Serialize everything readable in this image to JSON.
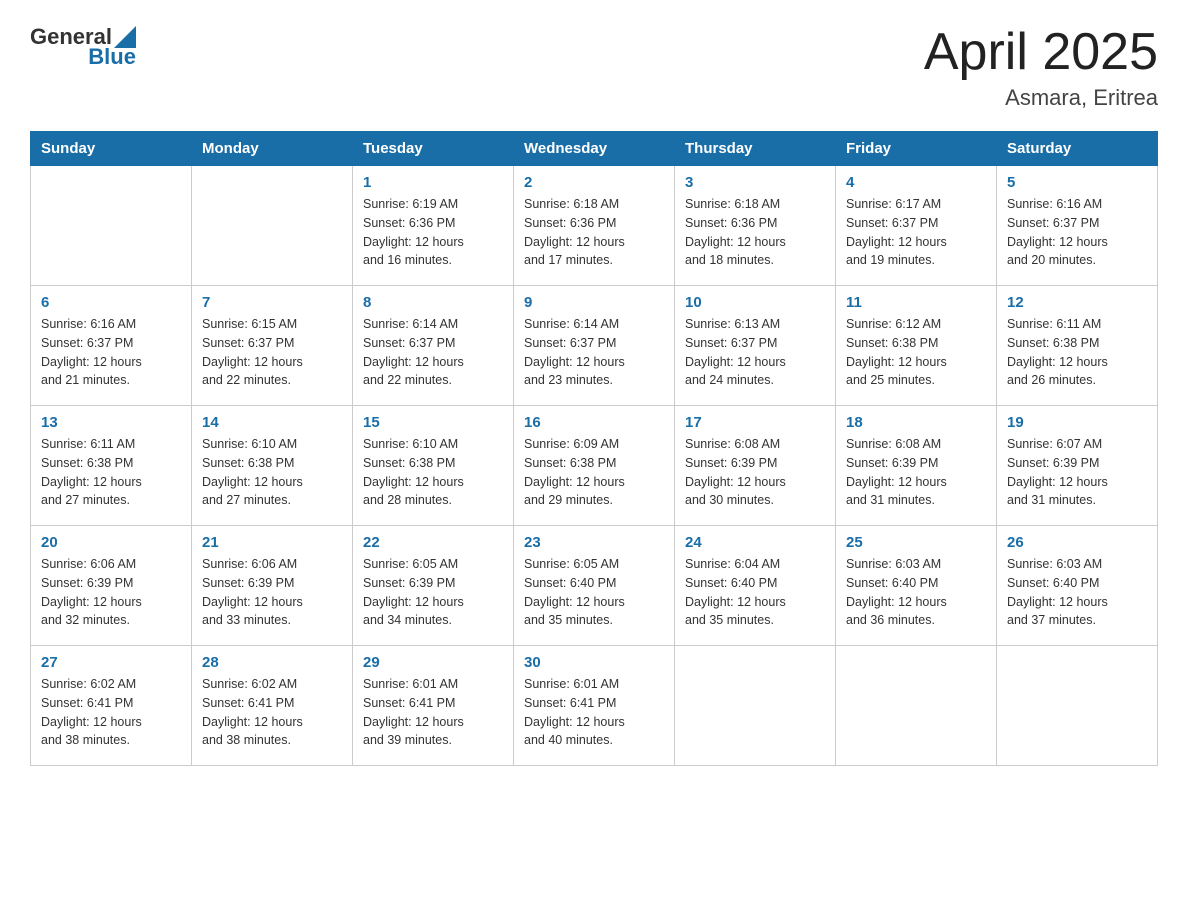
{
  "header": {
    "logo_general": "General",
    "logo_blue": "Blue",
    "title": "April 2025",
    "location": "Asmara, Eritrea"
  },
  "calendar": {
    "weekdays": [
      "Sunday",
      "Monday",
      "Tuesday",
      "Wednesday",
      "Thursday",
      "Friday",
      "Saturday"
    ],
    "weeks": [
      [
        {
          "day": "",
          "info": ""
        },
        {
          "day": "",
          "info": ""
        },
        {
          "day": "1",
          "info": "Sunrise: 6:19 AM\nSunset: 6:36 PM\nDaylight: 12 hours\nand 16 minutes."
        },
        {
          "day": "2",
          "info": "Sunrise: 6:18 AM\nSunset: 6:36 PM\nDaylight: 12 hours\nand 17 minutes."
        },
        {
          "day": "3",
          "info": "Sunrise: 6:18 AM\nSunset: 6:36 PM\nDaylight: 12 hours\nand 18 minutes."
        },
        {
          "day": "4",
          "info": "Sunrise: 6:17 AM\nSunset: 6:37 PM\nDaylight: 12 hours\nand 19 minutes."
        },
        {
          "day": "5",
          "info": "Sunrise: 6:16 AM\nSunset: 6:37 PM\nDaylight: 12 hours\nand 20 minutes."
        }
      ],
      [
        {
          "day": "6",
          "info": "Sunrise: 6:16 AM\nSunset: 6:37 PM\nDaylight: 12 hours\nand 21 minutes."
        },
        {
          "day": "7",
          "info": "Sunrise: 6:15 AM\nSunset: 6:37 PM\nDaylight: 12 hours\nand 22 minutes."
        },
        {
          "day": "8",
          "info": "Sunrise: 6:14 AM\nSunset: 6:37 PM\nDaylight: 12 hours\nand 22 minutes."
        },
        {
          "day": "9",
          "info": "Sunrise: 6:14 AM\nSunset: 6:37 PM\nDaylight: 12 hours\nand 23 minutes."
        },
        {
          "day": "10",
          "info": "Sunrise: 6:13 AM\nSunset: 6:37 PM\nDaylight: 12 hours\nand 24 minutes."
        },
        {
          "day": "11",
          "info": "Sunrise: 6:12 AM\nSunset: 6:38 PM\nDaylight: 12 hours\nand 25 minutes."
        },
        {
          "day": "12",
          "info": "Sunrise: 6:11 AM\nSunset: 6:38 PM\nDaylight: 12 hours\nand 26 minutes."
        }
      ],
      [
        {
          "day": "13",
          "info": "Sunrise: 6:11 AM\nSunset: 6:38 PM\nDaylight: 12 hours\nand 27 minutes."
        },
        {
          "day": "14",
          "info": "Sunrise: 6:10 AM\nSunset: 6:38 PM\nDaylight: 12 hours\nand 27 minutes."
        },
        {
          "day": "15",
          "info": "Sunrise: 6:10 AM\nSunset: 6:38 PM\nDaylight: 12 hours\nand 28 minutes."
        },
        {
          "day": "16",
          "info": "Sunrise: 6:09 AM\nSunset: 6:38 PM\nDaylight: 12 hours\nand 29 minutes."
        },
        {
          "day": "17",
          "info": "Sunrise: 6:08 AM\nSunset: 6:39 PM\nDaylight: 12 hours\nand 30 minutes."
        },
        {
          "day": "18",
          "info": "Sunrise: 6:08 AM\nSunset: 6:39 PM\nDaylight: 12 hours\nand 31 minutes."
        },
        {
          "day": "19",
          "info": "Sunrise: 6:07 AM\nSunset: 6:39 PM\nDaylight: 12 hours\nand 31 minutes."
        }
      ],
      [
        {
          "day": "20",
          "info": "Sunrise: 6:06 AM\nSunset: 6:39 PM\nDaylight: 12 hours\nand 32 minutes."
        },
        {
          "day": "21",
          "info": "Sunrise: 6:06 AM\nSunset: 6:39 PM\nDaylight: 12 hours\nand 33 minutes."
        },
        {
          "day": "22",
          "info": "Sunrise: 6:05 AM\nSunset: 6:39 PM\nDaylight: 12 hours\nand 34 minutes."
        },
        {
          "day": "23",
          "info": "Sunrise: 6:05 AM\nSunset: 6:40 PM\nDaylight: 12 hours\nand 35 minutes."
        },
        {
          "day": "24",
          "info": "Sunrise: 6:04 AM\nSunset: 6:40 PM\nDaylight: 12 hours\nand 35 minutes."
        },
        {
          "day": "25",
          "info": "Sunrise: 6:03 AM\nSunset: 6:40 PM\nDaylight: 12 hours\nand 36 minutes."
        },
        {
          "day": "26",
          "info": "Sunrise: 6:03 AM\nSunset: 6:40 PM\nDaylight: 12 hours\nand 37 minutes."
        }
      ],
      [
        {
          "day": "27",
          "info": "Sunrise: 6:02 AM\nSunset: 6:41 PM\nDaylight: 12 hours\nand 38 minutes."
        },
        {
          "day": "28",
          "info": "Sunrise: 6:02 AM\nSunset: 6:41 PM\nDaylight: 12 hours\nand 38 minutes."
        },
        {
          "day": "29",
          "info": "Sunrise: 6:01 AM\nSunset: 6:41 PM\nDaylight: 12 hours\nand 39 minutes."
        },
        {
          "day": "30",
          "info": "Sunrise: 6:01 AM\nSunset: 6:41 PM\nDaylight: 12 hours\nand 40 minutes."
        },
        {
          "day": "",
          "info": ""
        },
        {
          "day": "",
          "info": ""
        },
        {
          "day": "",
          "info": ""
        }
      ]
    ]
  }
}
